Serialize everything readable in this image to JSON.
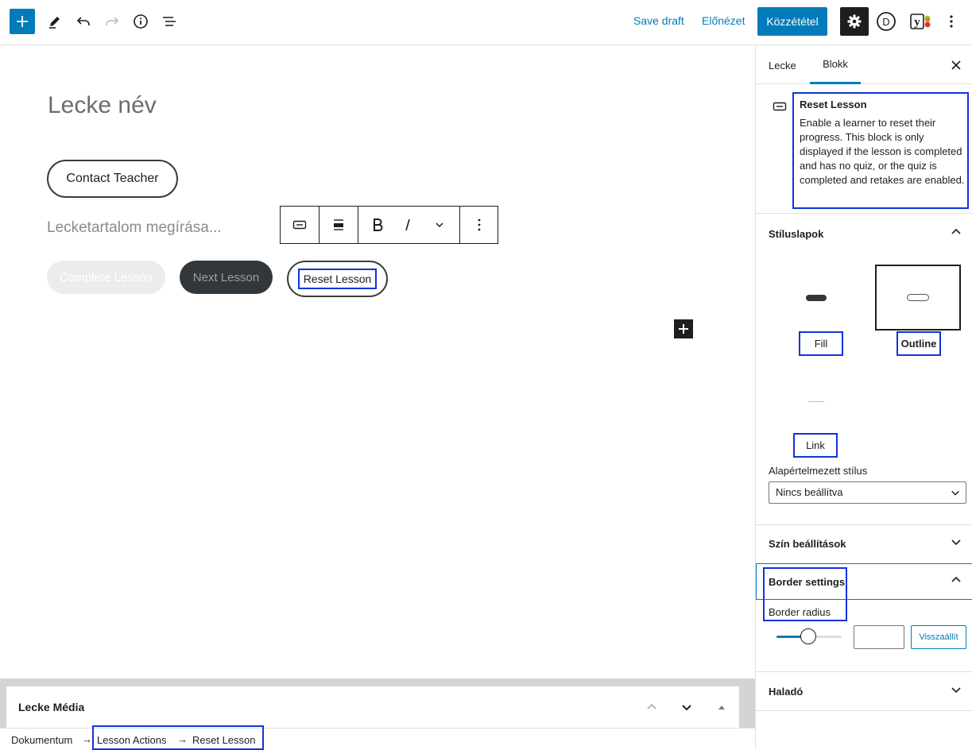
{
  "topbar": {
    "save_draft": "Save draft",
    "preview": "Előnézet",
    "publish": "Közzététel",
    "icons": [
      "plus-icon",
      "pencil-icon",
      "undo-icon",
      "redo-icon",
      "info-icon",
      "list-view-icon",
      "gear-icon",
      "avatar-d-icon",
      "yoast-icon",
      "kebab-menu-icon"
    ]
  },
  "editor": {
    "title_placeholder": "Lecke név",
    "contact_button": "Contact Teacher",
    "content_placeholder": "Lecketartalom megírása...",
    "complete_button": "Complete Lesson",
    "next_button": "Next Lesson",
    "reset_button": "Reset Lesson"
  },
  "meta": {
    "title": "Lecke Média"
  },
  "breadcrumb": {
    "items": [
      "Dokumentum",
      "Lesson Actions",
      "Reset Lesson"
    ],
    "separator": "→"
  },
  "sidebar": {
    "tabs": [
      "Lecke",
      "Blokk"
    ],
    "block": {
      "title": "Reset Lesson",
      "description": "Enable a learner to reset their progress. This block is only displayed if the lesson is completed and has no quiz, or the quiz is completed and retakes are enabled."
    },
    "styles": {
      "heading": "Stíluslapok",
      "options": [
        "Fill",
        "Outline",
        "Link"
      ],
      "default_label": "Alapértelmezett stílus",
      "default_value": "Nincs beállítva"
    },
    "color": {
      "heading": "Szín beállítások"
    },
    "border": {
      "heading": "Border settings",
      "radius_label": "Border radius",
      "reset": "Visszaállít"
    },
    "advanced": {
      "heading": "Haladó"
    }
  },
  "colors": {
    "accent": "#007cba",
    "dark": "#1e1e1e",
    "highlight": "#1133dd"
  }
}
